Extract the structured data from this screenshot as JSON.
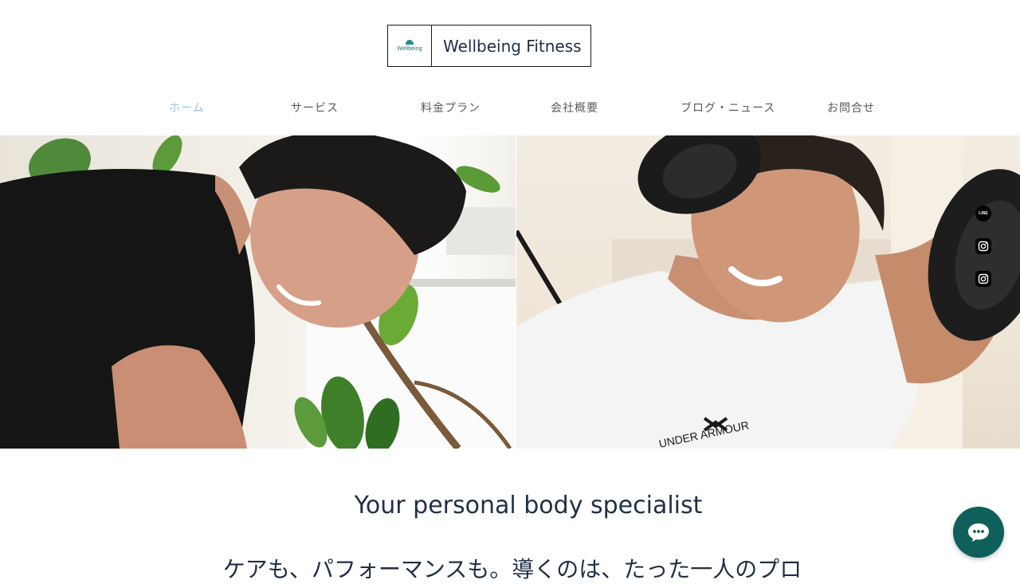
{
  "logo": {
    "mark_text": "Wellbeing",
    "name": "Wellbeing Fitness"
  },
  "nav": {
    "items": [
      {
        "label": "ホーム",
        "active": true
      },
      {
        "label": "サービス"
      },
      {
        "label": "料金プラン"
      },
      {
        "label": "会社概要"
      },
      {
        "label": "ブログ・ニュース"
      },
      {
        "label": "お問合せ"
      }
    ]
  },
  "hero": {
    "left_photo": "trainer-smiling-black-tshirt-with-plant",
    "right_photo": "trainer-lifting-dumbbells-white-tshirt",
    "shirt_text": "UNDER ARMOUR"
  },
  "social": {
    "items": [
      {
        "icon": "line-icon",
        "label": "LINE"
      },
      {
        "icon": "instagram-icon"
      },
      {
        "icon": "instagram-icon"
      }
    ]
  },
  "content": {
    "tagline": "Your personal body specialist",
    "jp_headline": "ケアも、パフォーマンスも。導くのは、たった一人のプロ"
  },
  "chat": {
    "icon": "chat-bubble-icon"
  },
  "colors": {
    "text_dark": "#1f2f45",
    "nav_active": "#9ec4d8",
    "chat_button": "#0f5f5b",
    "logo_teal": "#2a8c86"
  }
}
